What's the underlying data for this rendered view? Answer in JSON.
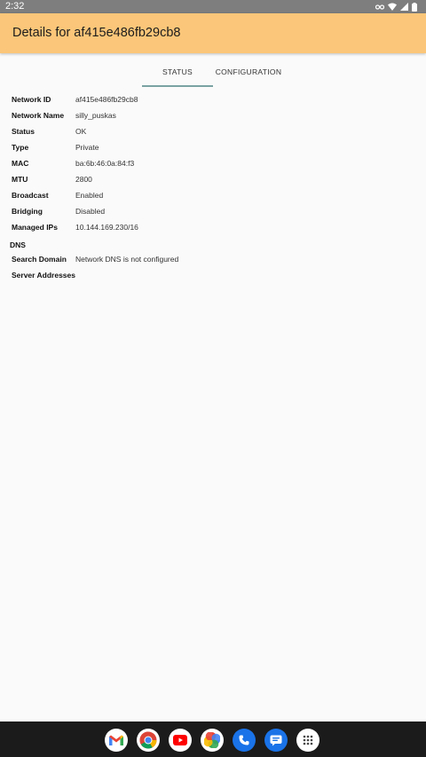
{
  "status_bar": {
    "time": "2:32"
  },
  "app_bar": {
    "title": "Details for af415e486fb29cb8",
    "color": "#fbc679"
  },
  "tabs": [
    {
      "label": "STATUS",
      "selected": true
    },
    {
      "label": "CONFIGURATION",
      "selected": false
    }
  ],
  "details": {
    "rows": [
      {
        "key": "Network ID",
        "value": "af415e486fb29cb8"
      },
      {
        "key": "Network Name",
        "value": "silly_puskas"
      },
      {
        "key": "Status",
        "value": "OK"
      },
      {
        "key": "Type",
        "value": "Private"
      },
      {
        "key": "MAC",
        "value": "ba:6b:46:0a:84:f3"
      },
      {
        "key": "MTU",
        "value": "2800"
      },
      {
        "key": "Broadcast",
        "value": "Enabled"
      },
      {
        "key": "Bridging",
        "value": "Disabled"
      },
      {
        "key": "Managed IPs",
        "value": "10.144.169.230/16"
      }
    ],
    "dns_title": "DNS",
    "dns_rows": [
      {
        "key": "Search Domain",
        "value": "Network DNS is not configured"
      },
      {
        "key": "Server Addresses",
        "value": ""
      }
    ]
  },
  "dock_icons": [
    "gmail-icon",
    "chrome-icon",
    "youtube-icon",
    "photos-icon",
    "phone-icon",
    "messages-icon",
    "app-drawer-icon"
  ]
}
